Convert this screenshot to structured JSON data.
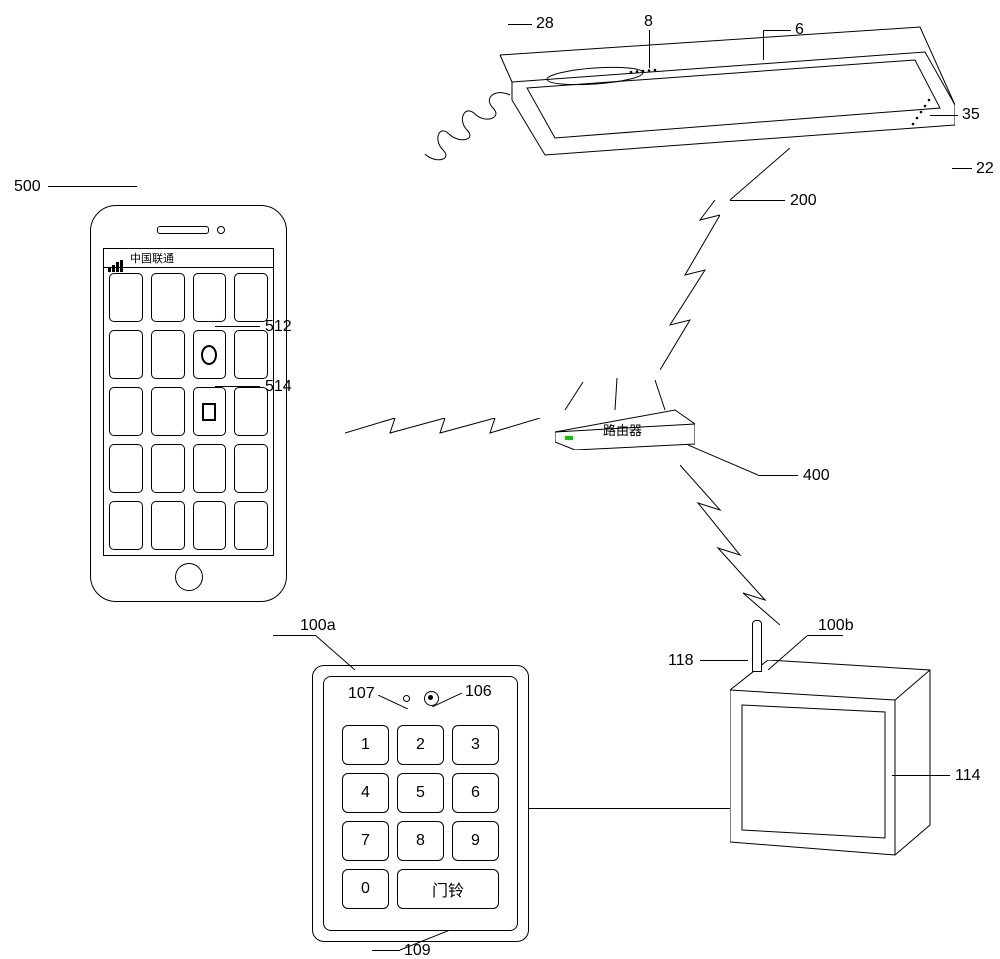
{
  "figure": {
    "labels": {
      "phone": "500",
      "app_circle": "512",
      "app_square": "514",
      "laptop_28": "28",
      "laptop_8": "8",
      "laptop_6": "6",
      "laptop_35": "35",
      "laptop_22": "22",
      "laptop_200": "200",
      "router_400": "400",
      "keypad_100a": "100a",
      "keypad_107": "107",
      "keypad_106": "106",
      "keypad_109": "109",
      "monitor_100b": "100b",
      "monitor_118": "118",
      "monitor_114": "114"
    },
    "phone": {
      "carrier": "中国联通"
    },
    "router": {
      "label": "路由器"
    },
    "keypad": {
      "keys": [
        "1",
        "2",
        "3",
        "4",
        "5",
        "6",
        "7",
        "8",
        "9",
        "0"
      ],
      "doorbell": "门铃"
    }
  }
}
